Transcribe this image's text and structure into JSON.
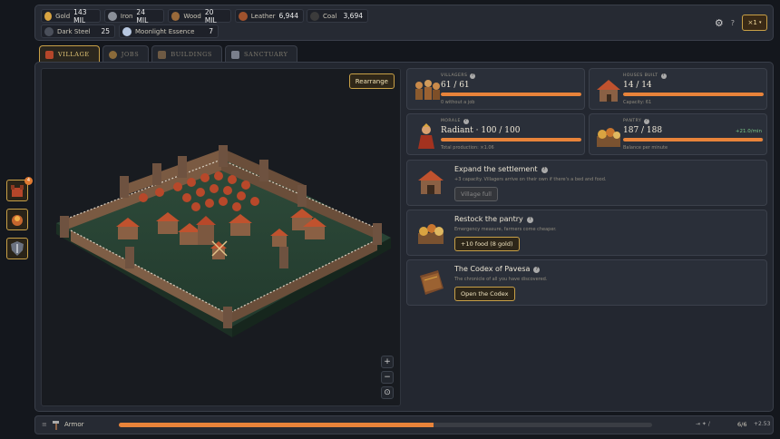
{
  "resources": [
    {
      "name": "Gold",
      "value": "143 MIL",
      "icon": "gold-coin-icon",
      "color": "#d9a441"
    },
    {
      "name": "Iron",
      "value": "24 MIL",
      "icon": "iron-ore-icon",
      "color": "#8a8f98"
    },
    {
      "name": "Wood",
      "value": "20 MIL",
      "icon": "wood-log-icon",
      "color": "#9a6a3a"
    },
    {
      "name": "Leather",
      "value": "6,944",
      "icon": "leather-hide-icon",
      "color": "#a0522d"
    },
    {
      "name": "Coal",
      "value": "3,694",
      "icon": "coal-icon",
      "color": "#3b3b3b"
    },
    {
      "name": "Dark Steel",
      "value": "25",
      "icon": "dark-steel-icon",
      "color": "#4a4f5a"
    },
    {
      "name": "Moonlight Essence",
      "value": "7",
      "icon": "moonlight-essence-icon",
      "color": "#b7c7e0"
    }
  ],
  "header": {
    "speed": "×1",
    "help": "?"
  },
  "tabs": [
    {
      "label": "Village",
      "active": true,
      "icon": "village-icon"
    },
    {
      "label": "Jobs",
      "active": false,
      "icon": "jobs-icon"
    },
    {
      "label": "Buildings",
      "active": false,
      "icon": "buildings-icon"
    },
    {
      "label": "Sanctuary",
      "active": false,
      "icon": "sanctuary-icon"
    }
  ],
  "map": {
    "rearrange": "Rearrange",
    "zoom_in": "+",
    "zoom_out": "−",
    "center": "⊙"
  },
  "stats": {
    "villagers": {
      "label": "Villagers",
      "value": "61 / 61",
      "sub": "0 without a job",
      "fill": 1.0
    },
    "houses": {
      "label": "Houses built",
      "value": "14 / 14",
      "sub": "Capacity: 61",
      "fill": 1.0
    },
    "morale": {
      "label": "Morale",
      "value": "Radiant · 100 / 100",
      "sub": "Total production: ×1.06",
      "fill": 1.0
    },
    "pantry": {
      "label": "Pantry",
      "value": "187 / 188",
      "sub": "Balance per minute",
      "rate": "+21.0/min",
      "fill": 0.995
    }
  },
  "actions": [
    {
      "title": "Expand the settlement",
      "desc": "+3 capacity. Villagers arrive on their own if there's a bed and food.",
      "button": "Village full",
      "disabled": true
    },
    {
      "title": "Restock the pantry",
      "desc": "Emergency measure, farmers come cheaper.",
      "button": "+10 food (8 gold)",
      "disabled": false
    },
    {
      "title": "The Codex of Pavesa",
      "desc": "The chronicle of all you have discovered.",
      "button": "Open the Codex",
      "disabled": false
    }
  ],
  "sidebar": {
    "badge": "4"
  },
  "bottom": {
    "label": "Armor",
    "progress": 0.59,
    "count": "6/6",
    "rate": "+2.53"
  }
}
